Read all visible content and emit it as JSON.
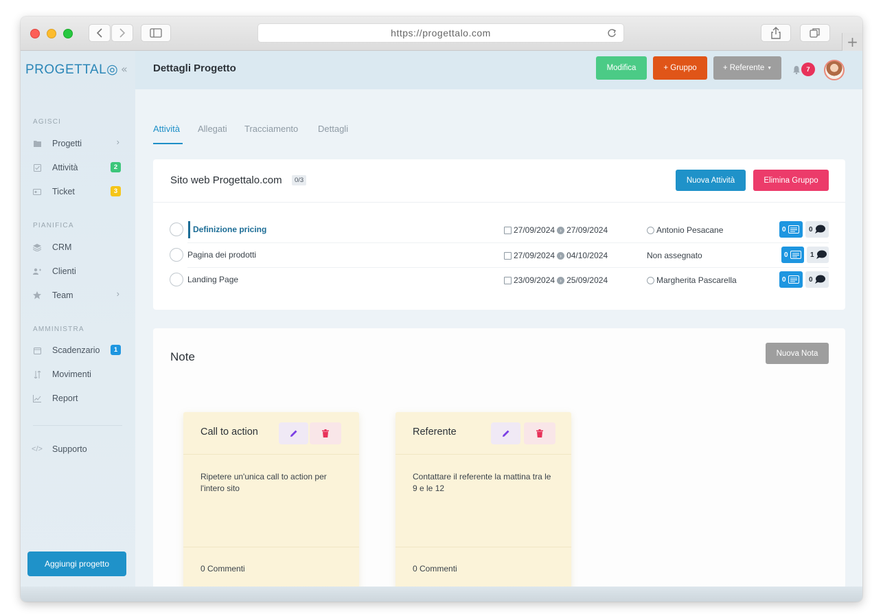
{
  "browser": {
    "url": "https://progettalo.com"
  },
  "sidebar": {
    "logo": "PROGETTAL◎",
    "sections": [
      {
        "title": "AGISCI"
      },
      {
        "title": "PIANIFICA"
      },
      {
        "title": "AMMINISTRA"
      }
    ],
    "items": [
      {
        "label": "Progetti",
        "icon": "folder-icon"
      },
      {
        "label": "Attività",
        "icon": "check-square-icon",
        "badge": "2",
        "badge_color": "#3cc67a"
      },
      {
        "label": "Ticket",
        "icon": "ticket-icon",
        "badge": "3",
        "badge_color": "#f5c518"
      },
      {
        "label": "CRM",
        "icon": "layers-icon"
      },
      {
        "label": "Clienti",
        "icon": "users-icon"
      },
      {
        "label": "Team",
        "icon": "star-icon"
      },
      {
        "label": "Scadenzario",
        "icon": "calendar-icon",
        "badge": "1",
        "badge_color": "#1e96e0"
      },
      {
        "label": "Movimenti",
        "icon": "arrows-icon"
      },
      {
        "label": "Report",
        "icon": "chart-icon"
      },
      {
        "label": "Supporto",
        "icon": "code-icon"
      }
    ],
    "add_project_label": "Aggiungi progetto"
  },
  "header": {
    "title": "Dettagli Progetto",
    "edit_label": "Modifica",
    "group_label": "+ Gruppo",
    "referent_label": "+ Referente",
    "notifications": "7"
  },
  "tabs": [
    "Attività",
    "Allegati",
    "Tracciamento",
    "Dettagli"
  ],
  "group": {
    "title": "Sito web Progettalo.com",
    "count": "0/3",
    "new_task_label": "Nuova Attività",
    "delete_group_label": "Elimina Gruppo",
    "tasks": [
      {
        "name": "Definizione pricing",
        "start": "27/09/2024",
        "end": "27/09/2024",
        "assignee": "Antonio Pesacane",
        "checklist": "0",
        "comments": "0"
      },
      {
        "name": "Pagina dei prodotti",
        "start": "27/09/2024",
        "end": "04/10/2024",
        "assignee": "Non assegnato",
        "checklist": "0",
        "comments": "1"
      },
      {
        "name": "Landing Page",
        "start": "23/09/2024",
        "end": "25/09/2024",
        "assignee": "Margherita Pascarella",
        "checklist": "0",
        "comments": "0"
      }
    ]
  },
  "notes": {
    "title": "Note",
    "new_note_label": "Nuova Nota",
    "items": [
      {
        "title": "Call to action",
        "body": "Ripetere un'unica call to action per l'intero sito",
        "comments": "0 Commenti"
      },
      {
        "title": "Referente",
        "body": "Contattare il referente la mattina tra le 9 e le 12",
        "comments": "0 Commenti"
      }
    ]
  },
  "colors": {
    "primary": "#1f92c9",
    "green": "#4bcb86",
    "orange": "#e05518",
    "gray": "#9e9e9e",
    "pink": "#ec3b6a"
  }
}
